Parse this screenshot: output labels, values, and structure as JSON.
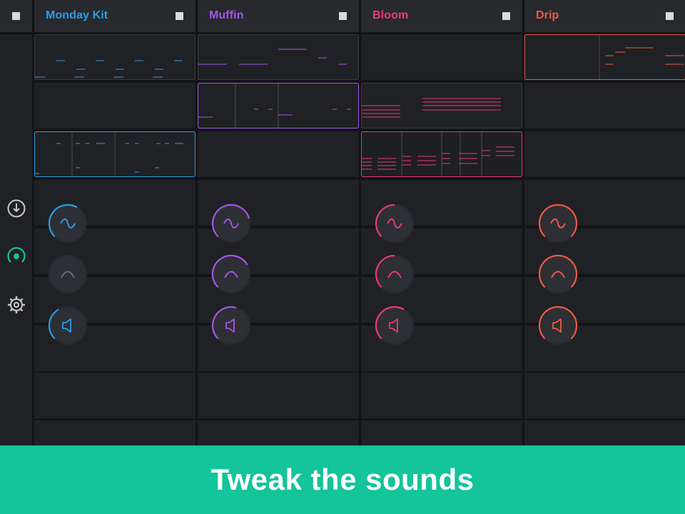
{
  "tracks": [
    {
      "name": "Monday Kit",
      "color": "#2b9de8",
      "stop_label": "stop-track"
    },
    {
      "name": "Muffin",
      "color": "#a356e8",
      "stop_label": "stop-track"
    },
    {
      "name": "Bloom",
      "color": "#e83c70",
      "stop_label": "stop-track"
    },
    {
      "name": "Drip",
      "color": "#ea5a48",
      "stop_label": "stop-track"
    }
  ],
  "sidebar": {
    "icons": [
      "download-icon",
      "record-icon",
      "settings-icon"
    ],
    "active_color": "#14c49a"
  },
  "knobs": {
    "rows": [
      "wave-icon",
      "envelope-icon",
      "volume-icon"
    ],
    "levels": [
      [
        0.55,
        0.0,
        0.35
      ],
      [
        0.7,
        0.65,
        0.5
      ],
      [
        0.45,
        0.45,
        0.55
      ],
      [
        0.9,
        0.9,
        0.9
      ]
    ]
  },
  "banner": {
    "text": "Tweak the sounds",
    "color": "#14c49a"
  }
}
